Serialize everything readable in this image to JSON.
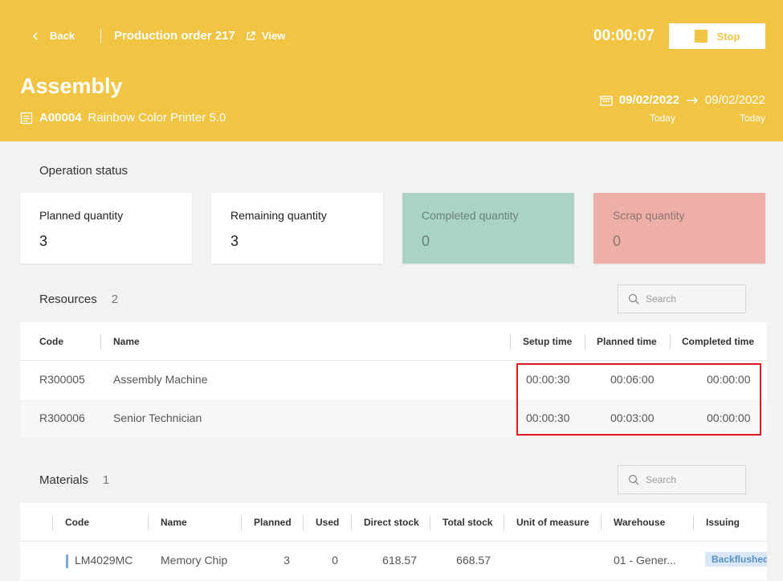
{
  "header": {
    "back_label": "Back",
    "order_title": "Production order 217",
    "view_label": "View",
    "timer": "00:00:07",
    "stop_label": "Stop",
    "operation": "Assembly",
    "item_code": "A00004",
    "item_name": "Rainbow Color Printer 5.0",
    "start_date": "09/02/2022",
    "end_date": "09/02/2022",
    "start_note": "Today",
    "end_note": "Today",
    "accent_color": "#f2c443"
  },
  "status": {
    "title": "Operation status",
    "cards": [
      {
        "label": "Planned quantity",
        "value": "3"
      },
      {
        "label": "Remaining quantity",
        "value": "3"
      },
      {
        "label": "Completed quantity",
        "value": "0"
      },
      {
        "label": "Scrap quantity",
        "value": "0"
      }
    ]
  },
  "resources": {
    "title": "Resources",
    "count": "2",
    "search_placeholder": "Search",
    "columns": [
      "Code",
      "Name",
      "Setup time",
      "Planned time",
      "Completed time"
    ],
    "rows": [
      {
        "code": "R300005",
        "name": "Assembly Machine",
        "setup": "00:00:30",
        "planned": "00:06:00",
        "completed": "00:00:00"
      },
      {
        "code": "R300006",
        "name": "Senior Technician",
        "setup": "00:00:30",
        "planned": "00:03:00",
        "completed": "00:00:00"
      }
    ]
  },
  "materials": {
    "title": "Materials",
    "count": "1",
    "search_placeholder": "Search",
    "columns": [
      "Code",
      "Name",
      "Planned",
      "Used",
      "Direct stock",
      "Total stock",
      "Unit of measure",
      "Warehouse",
      "Issuing"
    ],
    "rows": [
      {
        "code": "LM4029MC",
        "name": "Memory Chip",
        "planned": "3",
        "used": "0",
        "direct_stock": "618.57",
        "total_stock": "668.57",
        "uom": "",
        "warehouse": "01 - Gener...",
        "issuing": "Backflushed"
      }
    ]
  }
}
